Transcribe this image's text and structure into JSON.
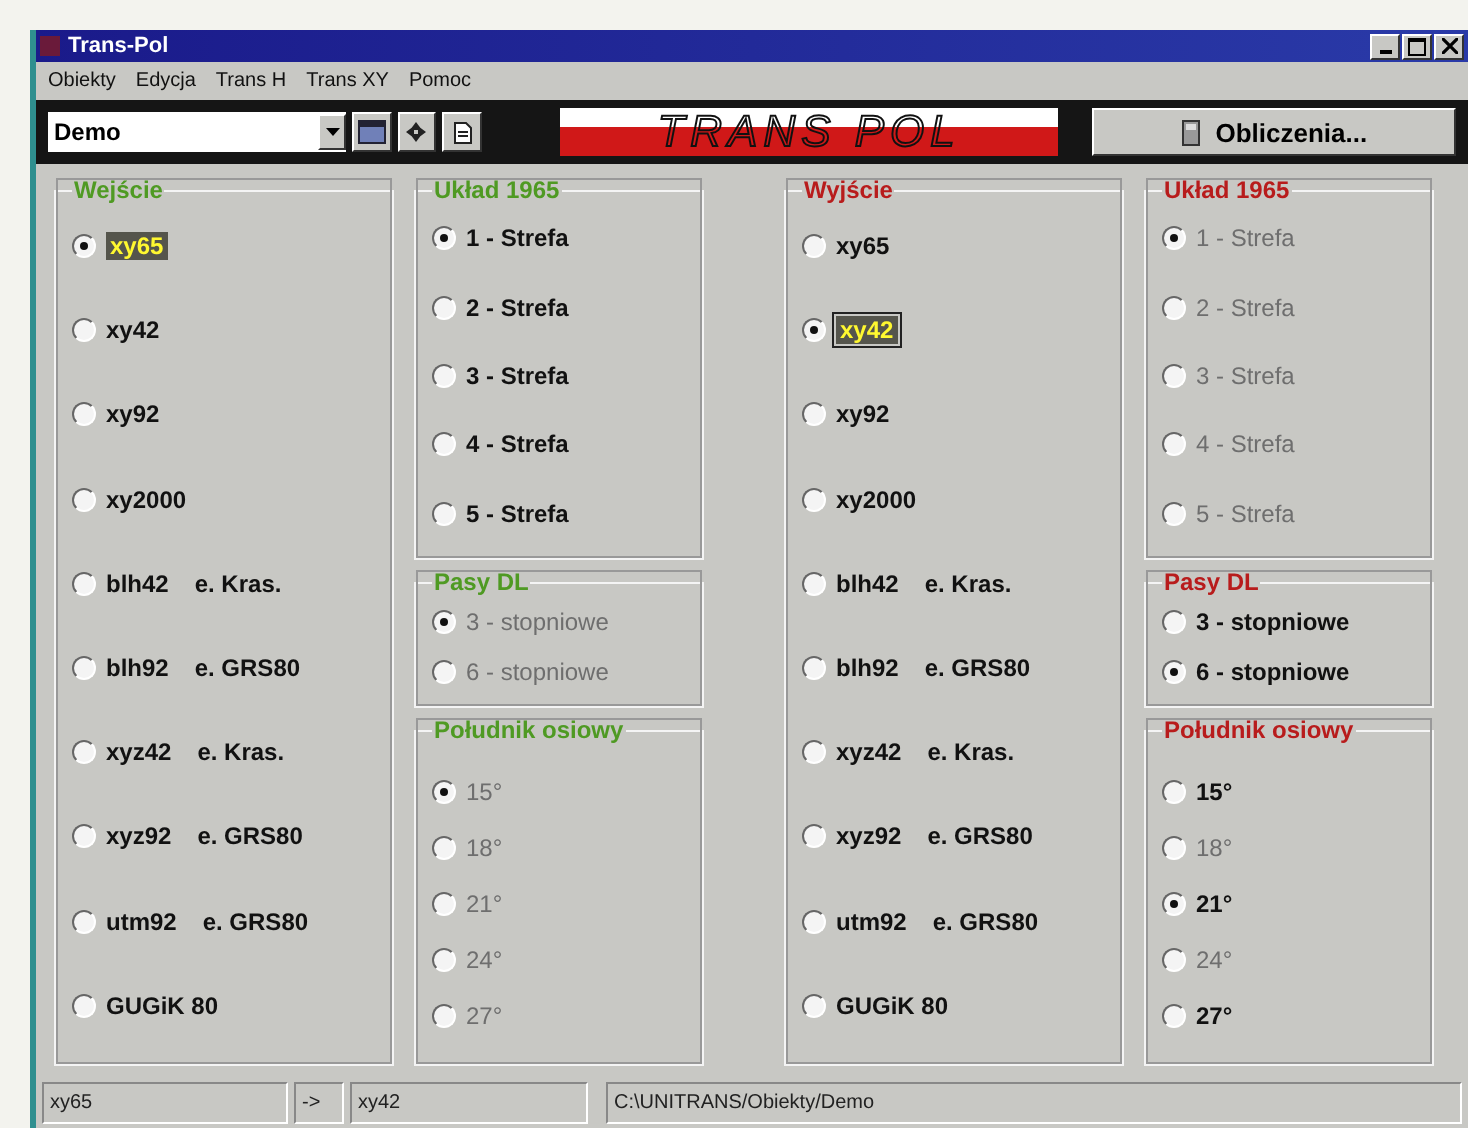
{
  "window": {
    "title": "Trans-Pol"
  },
  "menu": [
    "Obiekty",
    "Edycja",
    "Trans H",
    "Trans XY",
    "Pomoc"
  ],
  "toolbar": {
    "combo_value": "Demo",
    "logo": "TRANS POL",
    "button": "Obliczenia..."
  },
  "sides": [
    {
      "title": "Wejście",
      "color": "#4f9a23",
      "options": [
        {
          "label": "xy65",
          "selected": true,
          "focused": false
        },
        {
          "label": "xy42",
          "selected": false,
          "focused": false
        },
        {
          "label": "xy92",
          "selected": false,
          "focused": false
        },
        {
          "label": "xy2000",
          "selected": false,
          "focused": false
        },
        {
          "label": "blh42",
          "ellipsoid": "e. Kras.",
          "selected": false,
          "focused": false
        },
        {
          "label": "blh92",
          "ellipsoid": "e. GRS80",
          "selected": false,
          "focused": false
        },
        {
          "label": "xyz42",
          "ellipsoid": "e. Kras.",
          "selected": false,
          "focused": false
        },
        {
          "label": "xyz92",
          "ellipsoid": "e. GRS80",
          "selected": false,
          "focused": false
        },
        {
          "label": "utm92",
          "ellipsoid": "e. GRS80",
          "selected": false,
          "focused": false
        },
        {
          "label": "GUGiK 80",
          "selected": false,
          "focused": false
        }
      ],
      "groups": [
        {
          "title": "Układ 1965",
          "options": [
            {
              "label": "1 - Strefa",
              "selected": true,
              "disabled": false
            },
            {
              "label": "2 - Strefa",
              "selected": false,
              "disabled": false
            },
            {
              "label": "3 - Strefa",
              "selected": false,
              "disabled": false
            },
            {
              "label": "4 - Strefa",
              "selected": false,
              "disabled": false
            },
            {
              "label": "5 - Strefa",
              "selected": false,
              "disabled": false
            }
          ]
        },
        {
          "title": "Pasy DL",
          "options": [
            {
              "label": "3 - stopniowe",
              "selected": true,
              "disabled": true
            },
            {
              "label": "6 - stopniowe",
              "selected": false,
              "disabled": true
            }
          ]
        },
        {
          "title": "Południk osiowy",
          "options": [
            {
              "label": "15°",
              "selected": true,
              "disabled": true
            },
            {
              "label": "18°",
              "selected": false,
              "disabled": true
            },
            {
              "label": "21°",
              "selected": false,
              "disabled": true
            },
            {
              "label": "24°",
              "selected": false,
              "disabled": true
            },
            {
              "label": "27°",
              "selected": false,
              "disabled": true
            }
          ]
        }
      ]
    },
    {
      "title": "Wyjście",
      "color": "#b81c1c",
      "options": [
        {
          "label": "xy65",
          "selected": false,
          "focused": false
        },
        {
          "label": "xy42",
          "selected": true,
          "focused": true
        },
        {
          "label": "xy92",
          "selected": false,
          "focused": false
        },
        {
          "label": "xy2000",
          "selected": false,
          "focused": false
        },
        {
          "label": "blh42",
          "ellipsoid": "e. Kras.",
          "selected": false,
          "focused": false
        },
        {
          "label": "blh92",
          "ellipsoid": "e. GRS80",
          "selected": false,
          "focused": false
        },
        {
          "label": "xyz42",
          "ellipsoid": "e. Kras.",
          "selected": false,
          "focused": false
        },
        {
          "label": "xyz92",
          "ellipsoid": "e. GRS80",
          "selected": false,
          "focused": false
        },
        {
          "label": "utm92",
          "ellipsoid": "e. GRS80",
          "selected": false,
          "focused": false
        },
        {
          "label": "GUGiK 80",
          "selected": false,
          "focused": false
        }
      ],
      "groups": [
        {
          "title": "Układ 1965",
          "options": [
            {
              "label": "1 - Strefa",
              "selected": true,
              "disabled": true
            },
            {
              "label": "2 - Strefa",
              "selected": false,
              "disabled": true
            },
            {
              "label": "3 - Strefa",
              "selected": false,
              "disabled": true
            },
            {
              "label": "4 - Strefa",
              "selected": false,
              "disabled": true
            },
            {
              "label": "5 - Strefa",
              "selected": false,
              "disabled": true
            }
          ]
        },
        {
          "title": "Pasy DL",
          "options": [
            {
              "label": "3 - stopniowe",
              "selected": false,
              "disabled": false
            },
            {
              "label": "6 - stopniowe",
              "selected": true,
              "disabled": false
            }
          ]
        },
        {
          "title": "Południk osiowy",
          "options": [
            {
              "label": "15°",
              "selected": false,
              "disabled": false
            },
            {
              "label": "18°",
              "selected": false,
              "disabled": true
            },
            {
              "label": "21°",
              "selected": true,
              "disabled": false
            },
            {
              "label": "24°",
              "selected": false,
              "disabled": true
            },
            {
              "label": "27°",
              "selected": false,
              "disabled": false
            }
          ]
        }
      ]
    }
  ],
  "status_bar": {
    "from": "xy65",
    "arrow": "->",
    "to": "xy42",
    "path": "C:\\UNITRANS/Obiekty/Demo"
  }
}
